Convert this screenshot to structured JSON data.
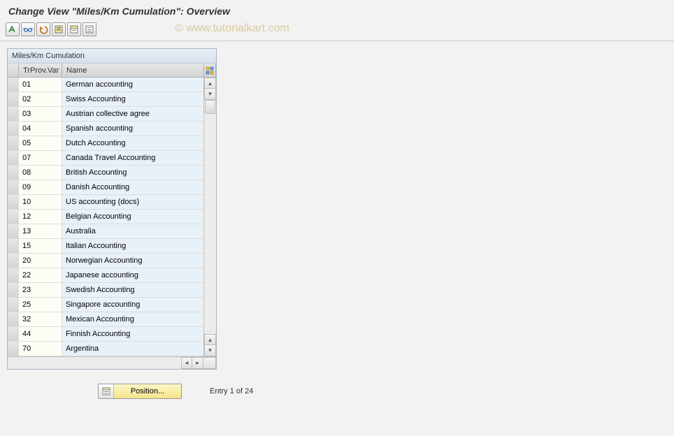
{
  "title": "Change View \"Miles/Km Cumulation\": Overview",
  "watermark": "© www.tutorialkart.com",
  "toolbar": {
    "items": [
      {
        "icon": "channel-select-icon",
        "color": "#2a7a2a"
      },
      {
        "icon": "glasses-back-icon",
        "color": "#1a5fb4"
      },
      {
        "icon": "undo-icon",
        "color": "#c06000"
      },
      {
        "icon": "new-entries-icon",
        "color": "#777"
      },
      {
        "icon": "copy-entries-icon",
        "color": "#777"
      },
      {
        "icon": "delimit-icon",
        "color": "#777"
      }
    ]
  },
  "table": {
    "title": "Miles/Km Cumulation",
    "columns": {
      "col1": "TrProv.Var",
      "col2": "Name"
    },
    "rows": [
      {
        "code": "01",
        "name": "German accounting"
      },
      {
        "code": "02",
        "name": "Swiss Accounting"
      },
      {
        "code": "03",
        "name": "Austrian collective agree"
      },
      {
        "code": "04",
        "name": "Spanish accounting"
      },
      {
        "code": "05",
        "name": "Dutch Accounting"
      },
      {
        "code": "07",
        "name": "Canada Travel Accounting"
      },
      {
        "code": "08",
        "name": "British Accounting"
      },
      {
        "code": "09",
        "name": "Danish Accounting"
      },
      {
        "code": "10",
        "name": "US accounting (docs)"
      },
      {
        "code": "12",
        "name": "Belgian Accounting"
      },
      {
        "code": "13",
        "name": "Australia"
      },
      {
        "code": "15",
        "name": "Italian Accounting"
      },
      {
        "code": "20",
        "name": "Norwegian Accounting"
      },
      {
        "code": "22",
        "name": "Japanese accounting"
      },
      {
        "code": "23",
        "name": "Swedish Accounting"
      },
      {
        "code": "25",
        "name": "Singapore accounting"
      },
      {
        "code": "32",
        "name": "Mexican Accounting"
      },
      {
        "code": "44",
        "name": "Finnish Accounting"
      },
      {
        "code": "70",
        "name": "Argentina"
      }
    ]
  },
  "footer": {
    "position_label": "Position...",
    "entry_status": "Entry 1 of 24"
  }
}
